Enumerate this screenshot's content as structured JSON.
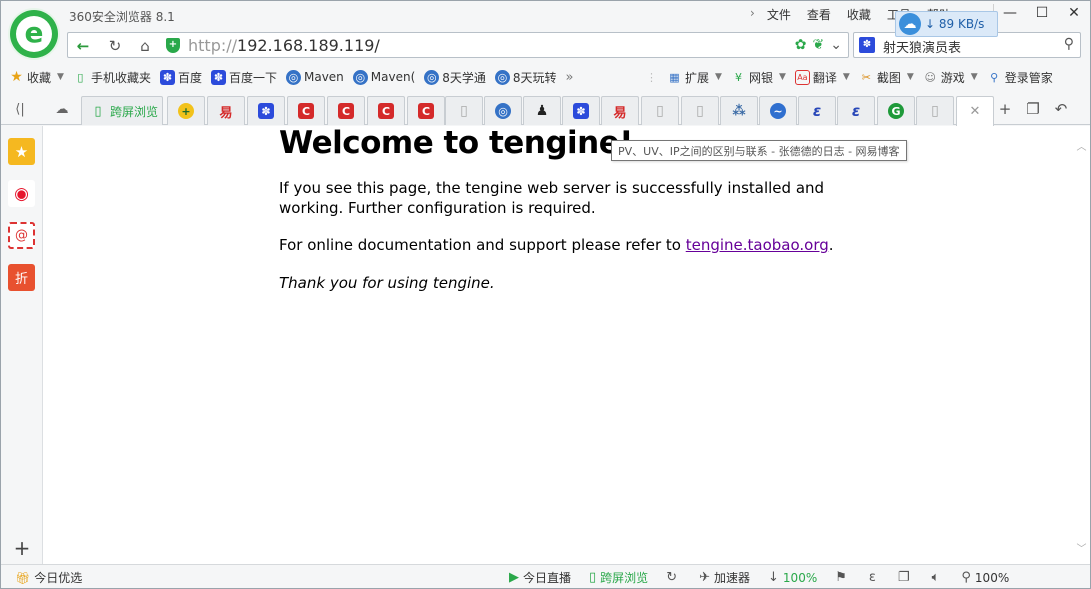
{
  "app": {
    "title": "360安全浏览器 8.1",
    "menu": [
      "文件",
      "查看",
      "收藏",
      "工具",
      "帮助"
    ],
    "download_rate": "89 KB/s"
  },
  "address": {
    "protocol": "http://",
    "host": "192.168.189.119/",
    "search_text": "射天狼演员表"
  },
  "bookmarks": {
    "favorites_label": "收藏",
    "items": [
      "手机收藏夹",
      "百度",
      "百度一下",
      "Maven",
      "Maven(",
      "8天学通",
      "8天玩转"
    ],
    "more": "»",
    "right_items": [
      "扩展",
      "网银",
      "翻译",
      "截图",
      "游戏",
      "登录管家"
    ]
  },
  "tabs": {
    "first_label": "跨屏浏览"
  },
  "page": {
    "heading": "Welcome to tengine!",
    "paragraph1": "If you see this page, the tengine web server is successfully installed and working. Further configuration is required.",
    "paragraph2_prefix": "For online documentation and support please refer to ",
    "link_text": "tengine.taobao.org",
    "paragraph2_suffix": ".",
    "paragraph3": "Thank you for using tengine.",
    "tooltip": "PV、UV、IP之间的区别与联系 - 张德德的日志 - 网易博客"
  },
  "statusbar": {
    "left": "今日优选",
    "live": "今日直播",
    "cross_screen": "跨屏浏览",
    "accelerator": "加速器",
    "download_pct": "100%",
    "zoom": "100%"
  }
}
